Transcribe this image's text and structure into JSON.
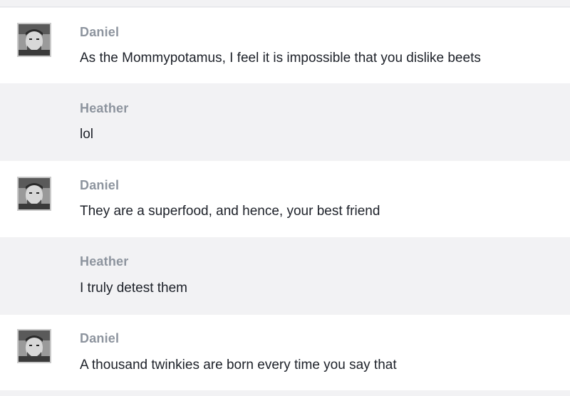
{
  "conversation": {
    "messages": [
      {
        "sender": "Daniel",
        "text": "As the Mommypotamus, I feel it is impossible that you dislike beets",
        "has_avatar": true,
        "avatar": "daniel-photo"
      },
      {
        "sender": "Heather",
        "text": "lol",
        "has_avatar": false
      },
      {
        "sender": "Daniel",
        "text": "They are a superfood, and hence, your best friend",
        "has_avatar": true,
        "avatar": "daniel-photo"
      },
      {
        "sender": "Heather",
        "text": "I truly detest them",
        "has_avatar": false
      },
      {
        "sender": "Daniel",
        "text": "A thousand twinkies are born every time you say that",
        "has_avatar": true,
        "avatar": "daniel-photo"
      }
    ]
  },
  "colors": {
    "row_white": "#ffffff",
    "row_gray": "#f2f2f4",
    "sender_name": "#8d949e",
    "message_text": "#1d2129"
  }
}
